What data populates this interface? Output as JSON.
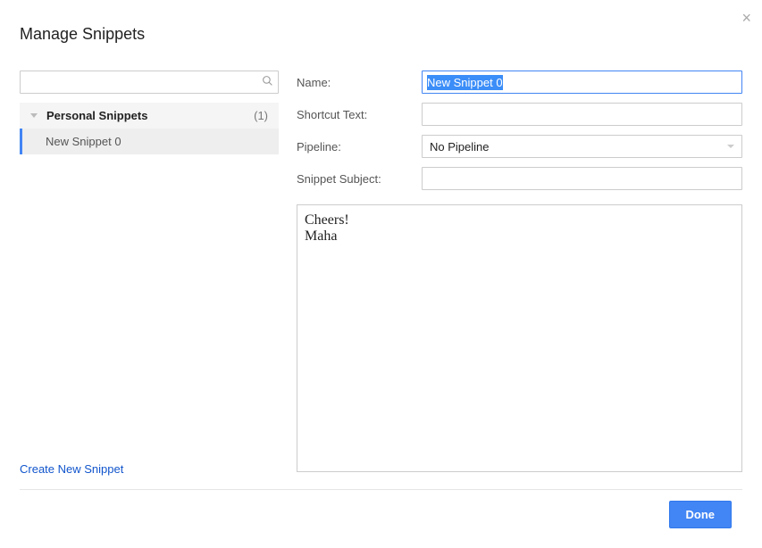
{
  "title": "Manage Snippets",
  "sidebar": {
    "category_label": "Personal Snippets",
    "category_count": "(1)",
    "items": [
      {
        "label": "New Snippet 0"
      }
    ]
  },
  "form": {
    "name_label": "Name:",
    "name_value": "New Snippet 0",
    "shortcut_label": "Shortcut Text:",
    "shortcut_value": "",
    "pipeline_label": "Pipeline:",
    "pipeline_value": "No Pipeline",
    "subject_label": "Snippet Subject:",
    "subject_value": "",
    "editor_content": "Cheers!\nMaha"
  },
  "actions": {
    "create_link": "Create New Snippet",
    "done_label": "Done"
  }
}
